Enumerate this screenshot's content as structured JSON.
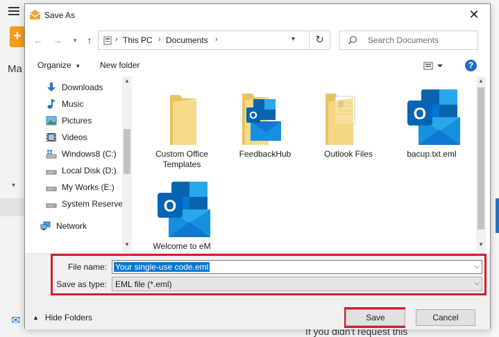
{
  "background": {
    "sidebar_heading": "Ma",
    "content_text": "If you didn't request this"
  },
  "dialog": {
    "title": "Save As",
    "close_symbol": "✕"
  },
  "address_bar": {
    "crumbs": [
      "This PC",
      "Documents"
    ]
  },
  "search": {
    "placeholder": "Search Documents"
  },
  "toolbar": {
    "organize_label": "Organize",
    "new_folder_label": "New folder",
    "help_symbol": "?"
  },
  "nav_pane": {
    "items": [
      {
        "label": "Downloads",
        "icon": "download-icon"
      },
      {
        "label": "Music",
        "icon": "music-icon"
      },
      {
        "label": "Pictures",
        "icon": "pictures-icon"
      },
      {
        "label": "Videos",
        "icon": "videos-icon"
      },
      {
        "label": "Windows8 (C:)",
        "icon": "drive-icon"
      },
      {
        "label": "Local Disk (D:)",
        "icon": "drive-icon"
      },
      {
        "label": "My Works (E:)",
        "icon": "drive-icon"
      },
      {
        "label": "System Reserved",
        "icon": "drive-icon"
      },
      {
        "label": "Network",
        "icon": "network-icon"
      }
    ]
  },
  "files": [
    {
      "name": "Custom Office Templates",
      "type": "folder"
    },
    {
      "name": "FeedbackHub",
      "type": "folder"
    },
    {
      "name": "Outlook Files",
      "type": "folder"
    },
    {
      "name": "bacup.txt.eml",
      "type": "eml"
    },
    {
      "name": "Welcome to eM",
      "type": "eml"
    }
  ],
  "form": {
    "file_name_label": "File name:",
    "file_name_value": "Your single-use code.eml",
    "save_type_label": "Save as type:",
    "save_type_value": "EML file (*.eml)",
    "hide_folders_label": "Hide Folders",
    "save_label": "Save",
    "cancel_label": "Cancel"
  },
  "colors": {
    "highlight": "#d0202a",
    "selection": "#0078d7",
    "outlook_blue": "#0a64ad",
    "folder_yellow": "#f5d87a"
  }
}
